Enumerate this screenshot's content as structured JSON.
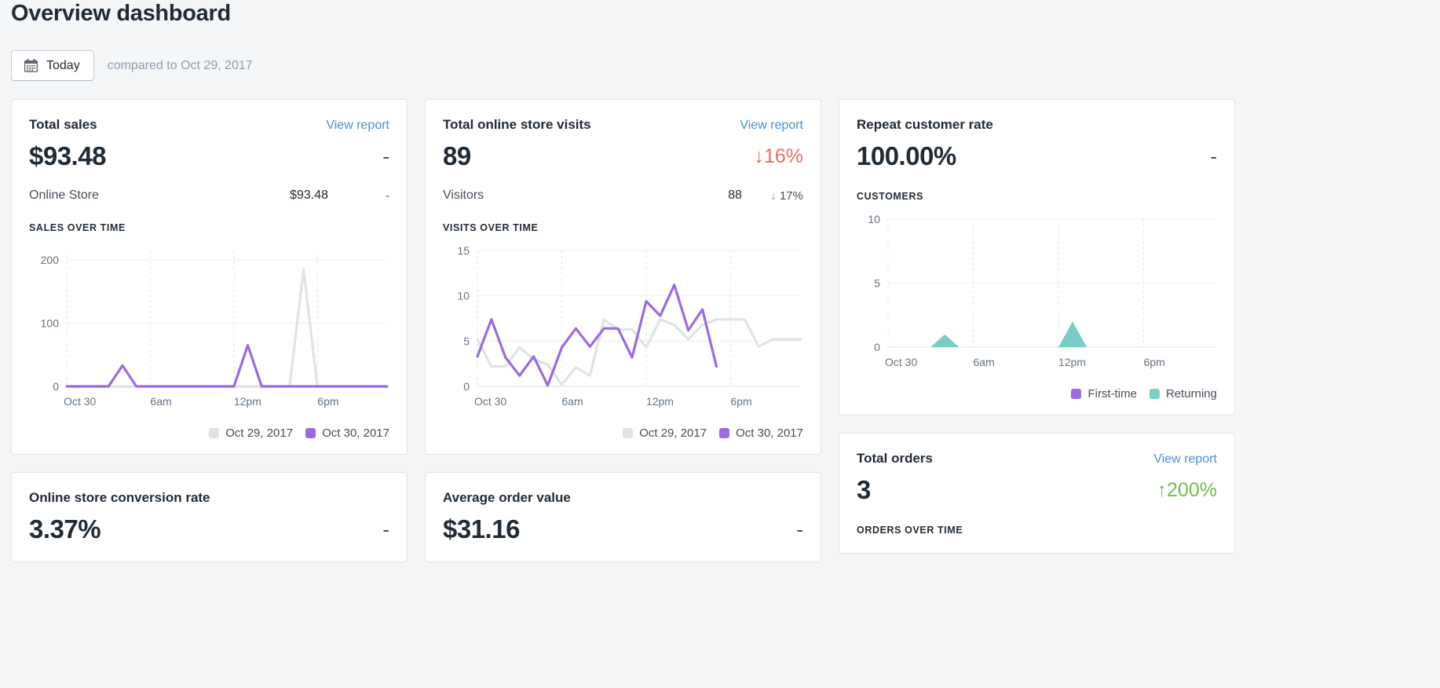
{
  "header": {
    "title": "Overview dashboard",
    "date_button_label": "Today",
    "date_button_icon": "calendar-icon",
    "compared_text": "compared to Oct 29, 2017"
  },
  "colors": {
    "purple": "#9c6ade",
    "gray_series": "#dfe3e8",
    "teal": "#79cdc4",
    "link_blue": "#4a8fd4",
    "negative_red": "#e0705a",
    "positive_green": "#6dbf4b",
    "text_dark": "#212b36",
    "text_muted": "#919eab"
  },
  "cards": {
    "total_sales": {
      "title": "Total sales",
      "view_report": "View report",
      "value": "$93.48",
      "delta": "-",
      "breakdown": {
        "label": "Online Store",
        "value": "$93.48",
        "delta": "-"
      },
      "chart_caption": "SALES OVER TIME"
    },
    "total_visits": {
      "title": "Total online store visits",
      "view_report": "View report",
      "value": "89",
      "delta": "↓16%",
      "breakdown": {
        "label": "Visitors",
        "value": "88",
        "delta_arrow": "↓",
        "delta": "17%"
      },
      "chart_caption": "VISITS OVER TIME"
    },
    "repeat_customer_rate": {
      "title": "Repeat customer rate",
      "value": "100.00%",
      "delta": "-",
      "chart_caption": "CUSTOMERS"
    },
    "total_orders": {
      "title": "Total orders",
      "view_report": "View report",
      "value": "3",
      "delta": "↑200%",
      "chart_caption": "ORDERS OVER TIME"
    },
    "conversion_rate": {
      "title": "Online store conversion rate",
      "value": "3.37%",
      "delta": "-"
    },
    "average_order_value": {
      "title": "Average order value",
      "value": "$31.16",
      "delta": "-"
    }
  },
  "legends": {
    "dates": [
      {
        "label": "Oct 29, 2017",
        "color": "#dfe3e8"
      },
      {
        "label": "Oct 30, 2017",
        "color": "#9c6ade"
      }
    ],
    "customers": [
      {
        "label": "First-time",
        "color": "#9c6ade"
      },
      {
        "label": "Returning",
        "color": "#79cdc4"
      }
    ]
  },
  "chart_data": [
    {
      "id": "sales_over_time",
      "type": "line",
      "title": "SALES OVER TIME",
      "xlabel": "",
      "ylabel": "",
      "ylim": [
        0,
        215
      ],
      "yticks": [
        0,
        100,
        200
      ],
      "ytick_labels": [
        "0",
        "100",
        "200"
      ],
      "xticks": [
        0,
        6,
        12,
        18
      ],
      "xtick_labels": [
        "Oct 30",
        "6am",
        "12pm",
        "6pm"
      ],
      "grid": true,
      "legend_position": "bottom-right",
      "x": [
        0,
        1,
        2,
        3,
        4,
        5,
        6,
        7,
        8,
        9,
        10,
        11,
        12,
        13,
        14,
        15,
        16,
        17,
        18,
        19,
        20,
        21,
        22,
        23
      ],
      "series": [
        {
          "name": "Oct 29, 2017",
          "color": "#dfe3e8",
          "values": [
            0,
            0,
            0,
            0,
            0,
            0,
            0,
            0,
            0,
            0,
            0,
            0,
            0,
            0,
            0,
            0,
            0,
            185,
            0,
            0,
            0,
            0,
            0,
            0
          ]
        },
        {
          "name": "Oct 30, 2017",
          "color": "#9c6ade",
          "values": [
            0,
            0,
            0,
            0,
            33,
            0,
            0,
            0,
            0,
            0,
            0,
            0,
            0,
            65,
            0,
            0,
            0,
            0,
            0,
            0,
            0,
            0,
            0,
            0
          ]
        }
      ]
    },
    {
      "id": "visits_over_time",
      "type": "line",
      "title": "VISITS OVER TIME",
      "ylim": [
        0,
        15
      ],
      "yticks": [
        0,
        5,
        10,
        15
      ],
      "ytick_labels": [
        "0",
        "5",
        "10",
        "15"
      ],
      "xticks": [
        0,
        6,
        12,
        18
      ],
      "xtick_labels": [
        "Oct 30",
        "6am",
        "12pm",
        "6pm"
      ],
      "grid": true,
      "legend_position": "bottom-right",
      "x": [
        0,
        1,
        2,
        3,
        4,
        5,
        6,
        7,
        8,
        9,
        10,
        11,
        12,
        13,
        14,
        15,
        16,
        17,
        18,
        19,
        20,
        21,
        22,
        23
      ],
      "series": [
        {
          "name": "Oct 29, 2017",
          "color": "#dfe3e8",
          "values": [
            5.2,
            2.2,
            2.2,
            4.3,
            3.0,
            2.4,
            0.2,
            2.1,
            1.2,
            7.4,
            6.3,
            6.3,
            4.3,
            7.4,
            6.8,
            5.2,
            6.8,
            7.4,
            7.4,
            7.4,
            4.4,
            5.2,
            5.2,
            5.2
          ]
        },
        {
          "name": "Oct 30, 2017",
          "color": "#9c6ade",
          "values": [
            3.3,
            7.4,
            3.2,
            1.2,
            3.3,
            0.1,
            4.3,
            6.4,
            4.4,
            6.4,
            6.4,
            3.2,
            9.4,
            7.8,
            11.2,
            6.2,
            8.5,
            2.2,
            null,
            null,
            null,
            null,
            null,
            null
          ]
        }
      ]
    },
    {
      "id": "customers",
      "type": "area",
      "title": "CUSTOMERS",
      "ylim": [
        0,
        10
      ],
      "yticks": [
        0,
        5,
        10
      ],
      "ytick_labels": [
        "0",
        "5",
        "10"
      ],
      "xticks": [
        0,
        6,
        12,
        18
      ],
      "xtick_labels": [
        "Oct 30",
        "6am",
        "12pm",
        "6pm"
      ],
      "grid": true,
      "legend_position": "bottom-right",
      "x": [
        0,
        1,
        2,
        3,
        4,
        5,
        6,
        7,
        8,
        9,
        10,
        11,
        12,
        13,
        14,
        15,
        16,
        17,
        18,
        19,
        20,
        21,
        22,
        23
      ],
      "series": [
        {
          "name": "First-time",
          "color": "#9c6ade",
          "values": [
            0,
            0,
            0,
            0,
            0,
            0,
            0,
            0,
            0,
            0,
            0,
            0,
            0,
            0,
            0,
            0,
            0,
            0,
            0,
            0,
            0,
            0,
            0,
            0
          ]
        },
        {
          "name": "Returning",
          "color": "#79cdc4",
          "values": [
            0,
            0,
            0,
            0,
            1,
            0,
            0,
            0,
            0,
            0,
            0,
            0,
            0,
            2,
            0,
            0,
            0,
            0,
            0,
            0,
            0,
            0,
            0,
            0
          ]
        }
      ]
    }
  ]
}
